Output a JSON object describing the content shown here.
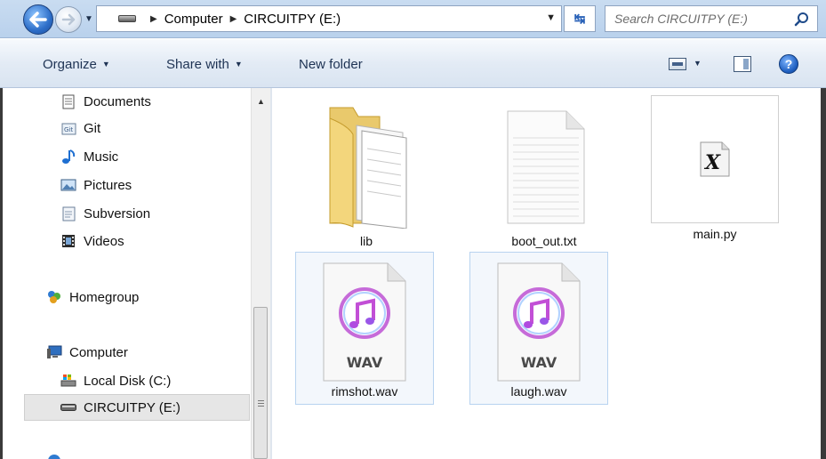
{
  "address": {
    "crumbs": [
      "Computer",
      "CIRCUITPY (E:)"
    ],
    "search_placeholder": "Search CIRCUITPY (E:)"
  },
  "toolbar": {
    "organize": "Organize",
    "share_with": "Share with",
    "new_folder": "New folder"
  },
  "navpane": {
    "libraries": [
      "Documents",
      "Git",
      "Music",
      "Pictures",
      "Subversion",
      "Videos"
    ],
    "homegroup": "Homegroup",
    "computer": "Computer",
    "drives": [
      "Local Disk (C:)",
      "CIRCUITPY (E:)"
    ],
    "selected": "CIRCUITPY (E:)"
  },
  "files": [
    {
      "name": "lib",
      "type": "folder"
    },
    {
      "name": "boot_out.txt",
      "type": "text"
    },
    {
      "name": "main.py",
      "type": "python"
    },
    {
      "name": "rimshot.wav",
      "type": "audio",
      "badge": "WAV"
    },
    {
      "name": "laugh.wav",
      "type": "audio",
      "badge": "WAV"
    }
  ],
  "colors": {
    "chrome": "#c9dcf1",
    "selection_border": "#b8d3f0",
    "link": "#1e3354"
  }
}
